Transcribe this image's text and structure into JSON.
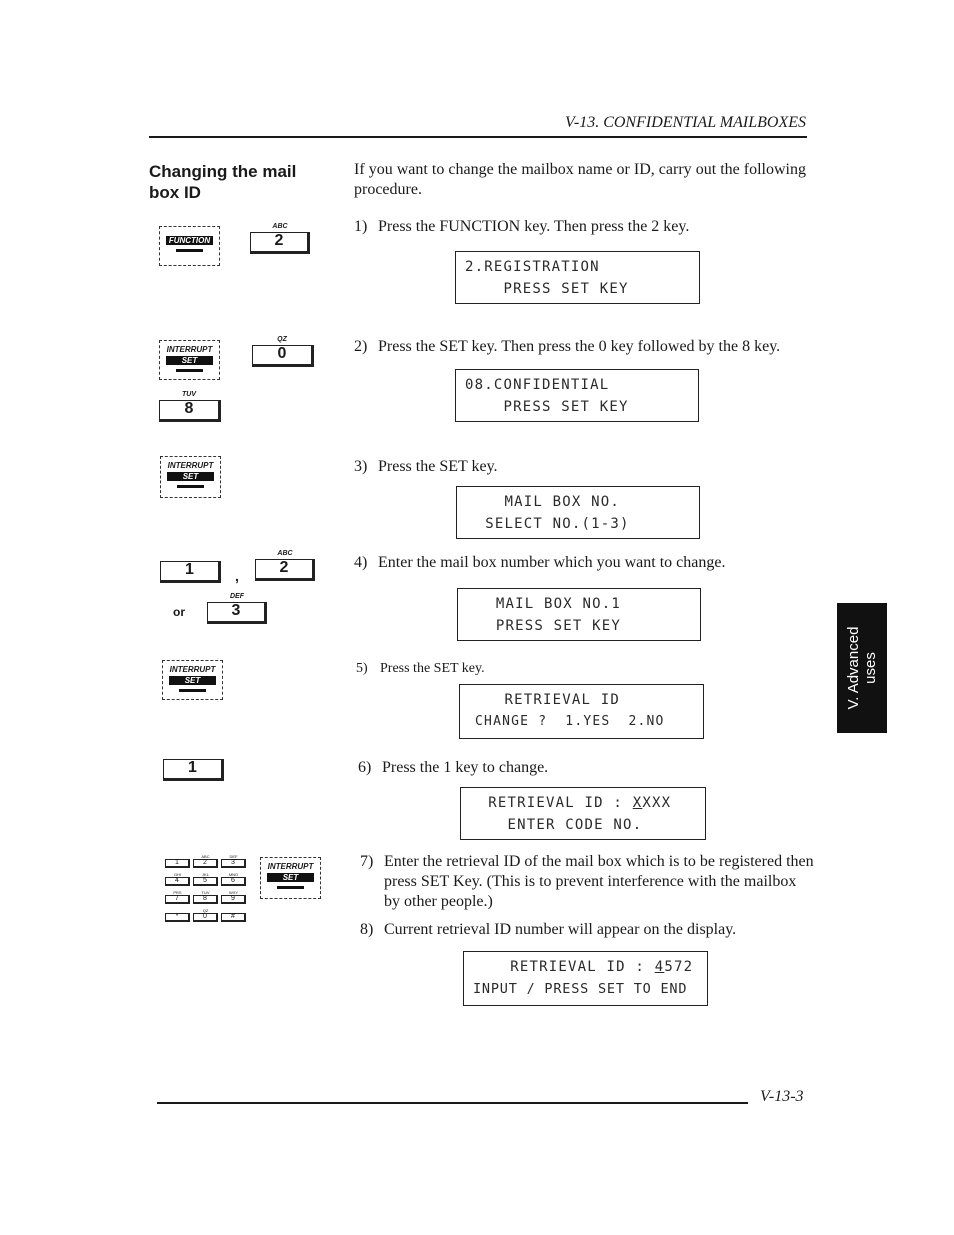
{
  "header": {
    "title": "V-13. CONFIDENTIAL MAILBOXES"
  },
  "section": {
    "title": "Changing the mail box ID",
    "intro": "If you want to change the mailbox name or ID, carry out the following procedure."
  },
  "steps": [
    {
      "num": "1)",
      "text": "Press the FUNCTION key. Then press the 2 key.",
      "lcd": [
        "2.REGISTRATION",
        "    PRESS SET KEY"
      ]
    },
    {
      "num": "2)",
      "text": "Press the SET key. Then press the 0 key followed by the 8 key.",
      "lcd": [
        "08.CONFIDENTIAL",
        "    PRESS SET KEY"
      ]
    },
    {
      "num": "3)",
      "text": "Press the SET key.",
      "lcd": [
        "    MAIL BOX NO.",
        "  SELECT NO.(1-3)"
      ]
    },
    {
      "num": "4)",
      "text": "Enter the mail box number which you want to change.",
      "lcd": [
        "   MAIL BOX NO.1",
        "   PRESS SET KEY"
      ]
    },
    {
      "num": "5)",
      "text": "Press the SET key.",
      "lcd": [
        "    RETRIEVAL ID",
        " CHANGE ?  1.YES  2.NO"
      ]
    },
    {
      "num": "6)",
      "text": "Press the 1 key to change.",
      "lcd": [
        "  RETRIEVAL ID : ",
        "    ENTER CODE NO."
      ],
      "lcd_underlined": "X",
      "lcd_rest": "XXX"
    },
    {
      "num": "7)",
      "text": "Enter the retrieval ID of the mail box which is to be registered then press SET Key. (This is to prevent interference with the mailbox by other people.)"
    },
    {
      "num": "8)",
      "text": "Current retrieval ID number will appear on the display.",
      "lcd": [
        "  RETRIEVAL ID : ",
        "INPUT / PRESS SET TO END"
      ],
      "lcd_underlined": "4",
      "lcd_rest": "572"
    }
  ],
  "keys": {
    "function_label": "FUNCTION",
    "interrupt_label": "INTERRUPT",
    "set_label": "SET",
    "k2": {
      "digit": "2",
      "letters": "ABC"
    },
    "k0": {
      "digit": "0",
      "letters": "QZ"
    },
    "k8": {
      "digit": "8",
      "letters": "TUV"
    },
    "k1": {
      "digit": "1",
      "letters": ""
    },
    "k3": {
      "digit": "3",
      "letters": "DEF"
    },
    "separator": ",",
    "or_label": "or",
    "keypad": [
      {
        "digit": "1",
        "letters": ""
      },
      {
        "digit": "2",
        "letters": "ABC"
      },
      {
        "digit": "3",
        "letters": "DEF"
      },
      {
        "digit": "4",
        "letters": "GHI"
      },
      {
        "digit": "5",
        "letters": "JKL"
      },
      {
        "digit": "6",
        "letters": "MNO"
      },
      {
        "digit": "7",
        "letters": "PRS"
      },
      {
        "digit": "8",
        "letters": "TUV"
      },
      {
        "digit": "9",
        "letters": "WXY"
      },
      {
        "digit": "*",
        "letters": ""
      },
      {
        "digit": "0",
        "letters": "QZ"
      },
      {
        "digit": "#",
        "letters": ""
      }
    ]
  },
  "side_tab": {
    "line1": "V. Advanced",
    "line2": "uses"
  },
  "footer": {
    "page_number": "V-13-3"
  }
}
